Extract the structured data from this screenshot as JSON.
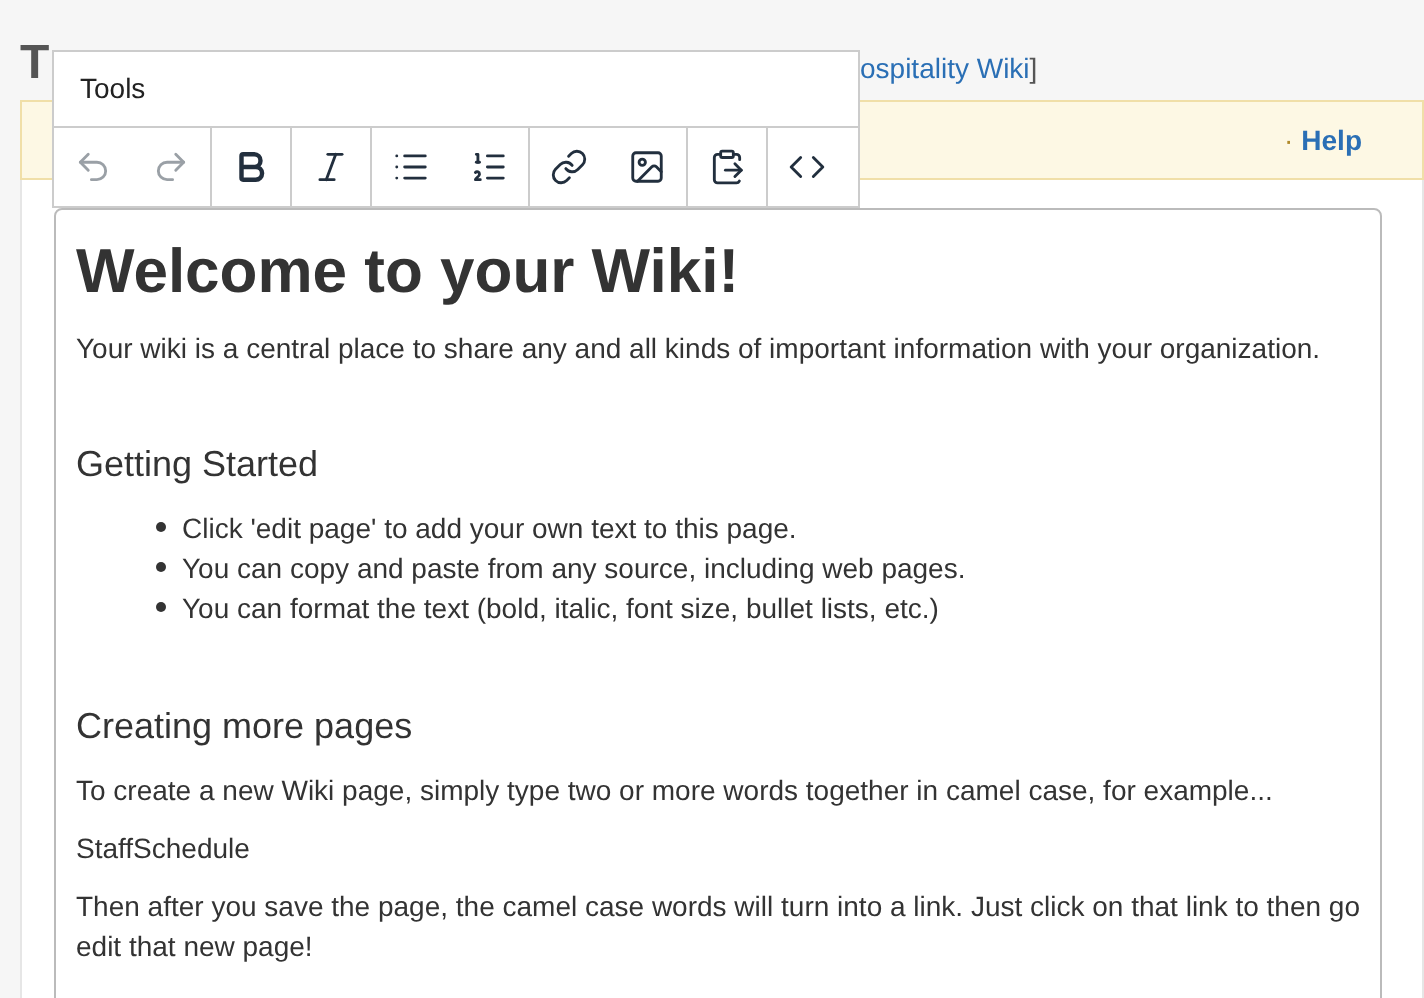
{
  "page_title": "T",
  "breadcrumb": {
    "link": "ospitality Wiki",
    "close_bracket": "]"
  },
  "notice_bar": {
    "bullet": "·",
    "help_link": "Help"
  },
  "tools_popup": {
    "title": "Tools",
    "groups": [
      [
        {
          "kind": "undo",
          "disabled": true
        },
        {
          "kind": "redo",
          "disabled": true
        }
      ],
      [
        {
          "kind": "bold",
          "disabled": false
        }
      ],
      [
        {
          "kind": "italic",
          "disabled": false
        }
      ],
      [
        {
          "kind": "bullets",
          "disabled": false
        },
        {
          "kind": "numbers",
          "disabled": false
        }
      ],
      [
        {
          "kind": "link",
          "disabled": false
        },
        {
          "kind": "image",
          "disabled": false
        }
      ],
      [
        {
          "kind": "paste",
          "disabled": false
        }
      ],
      [
        {
          "kind": "code",
          "disabled": false
        }
      ]
    ]
  },
  "editor": {
    "blocks": [
      {
        "kind": "h1",
        "text": "Welcome to your Wiki!"
      },
      {
        "kind": "p",
        "text": "Your wiki is a central place to share any and all kinds of important information with your organization."
      },
      {
        "kind": "spacer"
      },
      {
        "kind": "h2",
        "text": "Getting Started"
      },
      {
        "kind": "ul",
        "items": [
          "Click 'edit page' to add your own text to this page.",
          "You can copy and paste from any source, including web pages.",
          "You can format the text (bold, italic, font size, bullet lists, etc.)"
        ]
      },
      {
        "kind": "spacer"
      },
      {
        "kind": "h2",
        "text": "Creating more pages"
      },
      {
        "kind": "p",
        "text": "To create a new Wiki page, simply type two or more words together in camel case, for example..."
      },
      {
        "kind": "p",
        "text": "StaffSchedule"
      },
      {
        "kind": "p",
        "text": "Then after you save the page, the camel case words will turn into a link. Just click on that link to then go edit that new page!"
      }
    ]
  }
}
